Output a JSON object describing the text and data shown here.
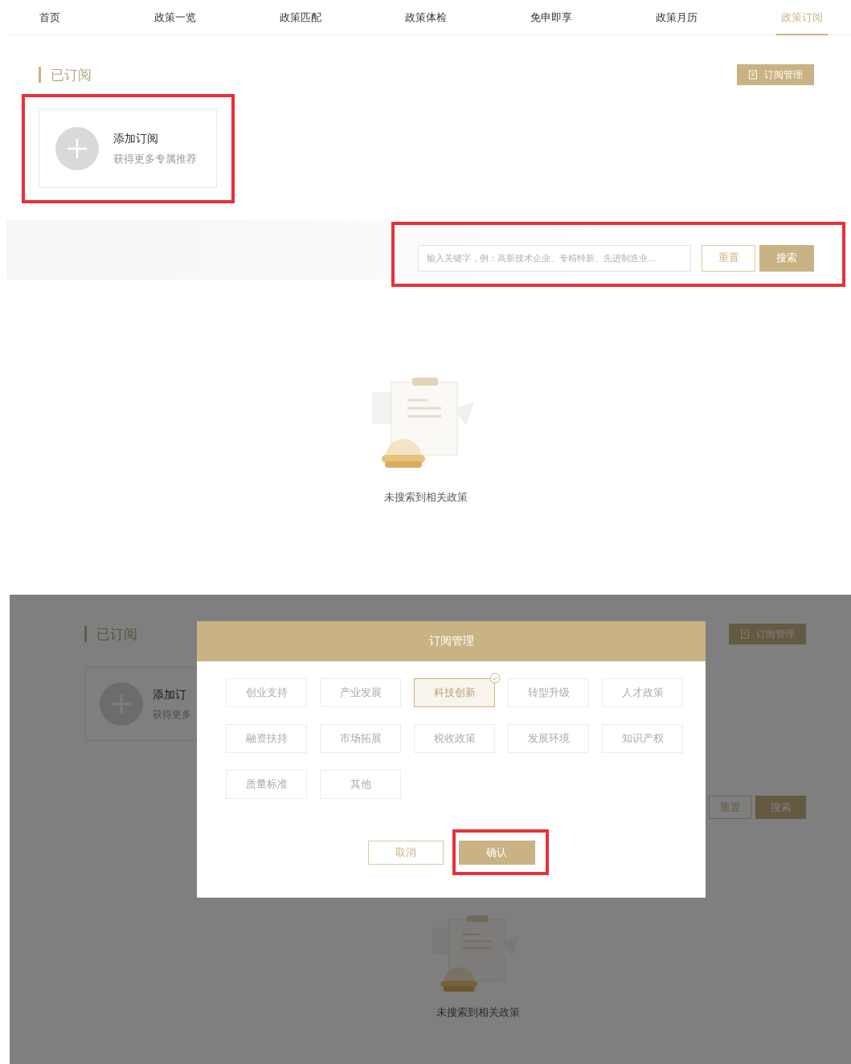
{
  "nav": {
    "items": [
      {
        "label": "首页",
        "selected": false
      },
      {
        "label": "政策一览",
        "selected": false
      },
      {
        "label": "政策匹配",
        "selected": false
      },
      {
        "label": "政策体检",
        "selected": false
      },
      {
        "label": "免申即享",
        "selected": false
      },
      {
        "label": "政策月历",
        "selected": false
      },
      {
        "label": "政策订阅",
        "selected": true
      }
    ]
  },
  "page": {
    "section_title": "已订阅",
    "manage_button": "订阅管理",
    "add_card": {
      "title": "添加订阅",
      "subtitle": "获得更多专属推荐",
      "highlighted": true
    },
    "search": {
      "placeholder": "输入关键字，例：高新技术企业、专精特新、先进制造业...",
      "reset_button": "重置",
      "search_button": "搜索",
      "highlighted": true
    },
    "empty_text": "未搜索到相关政策"
  },
  "dialog_screen": {
    "background": {
      "section_title": "已订阅",
      "manage_button": "订阅管理",
      "add_card_title": "添加订",
      "add_card_subtitle": "获得更多",
      "reset_button": "重置",
      "search_button": "搜索",
      "empty_text": "未搜索到相关政策"
    },
    "dialog": {
      "title": "订阅管理",
      "tags": [
        {
          "label": "创业支持",
          "selected": false
        },
        {
          "label": "产业发展",
          "selected": false
        },
        {
          "label": "科技创新",
          "selected": true
        },
        {
          "label": "转型升级",
          "selected": false
        },
        {
          "label": "人才政策",
          "selected": false
        },
        {
          "label": "融资扶持",
          "selected": false
        },
        {
          "label": "市场拓展",
          "selected": false
        },
        {
          "label": "税收政策",
          "selected": false
        },
        {
          "label": "发展环境",
          "selected": false
        },
        {
          "label": "知识产权",
          "selected": false
        },
        {
          "label": "质量标准",
          "selected": false
        },
        {
          "label": "其他",
          "selected": false
        }
      ],
      "cancel_button": "取消",
      "confirm_button": "确认",
      "confirm_highlighted": true
    }
  }
}
